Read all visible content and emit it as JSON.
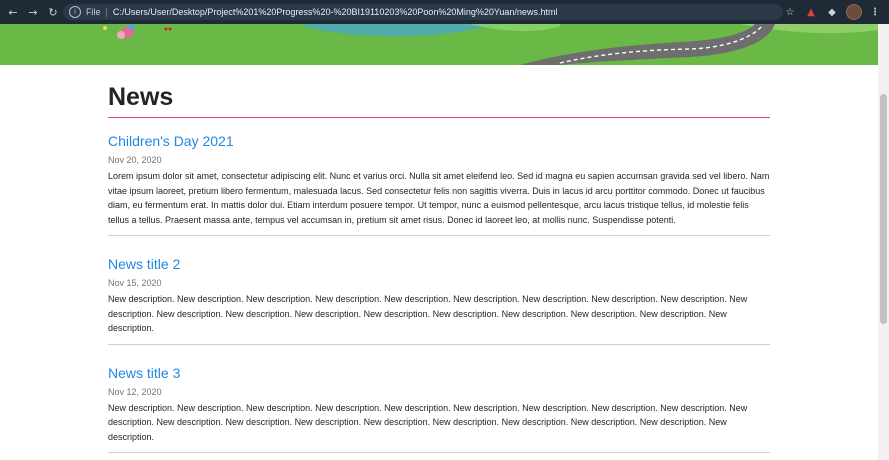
{
  "browser": {
    "scheme_label": "File",
    "url": "C:/Users/User/Desktop/Project%201%20Progress%20-%20BI19110203%20Poon%20Ming%20Yuan/news.html",
    "icons": {
      "back": "arrow-left-icon",
      "forward": "arrow-right-icon",
      "reload": "reload-icon",
      "info": "info-icon",
      "bookmark": "star-icon",
      "extension_a": "extension-icon",
      "extensions": "puzzle-icon",
      "profile": "avatar-icon",
      "menu": "kebab-menu-icon"
    }
  },
  "colors": {
    "banner_grass": "#6ab947",
    "title_rule": "#e83e8c",
    "post_title": "#1e88e5"
  },
  "page": {
    "title": "News"
  },
  "posts": [
    {
      "title": "Children's Day 2021",
      "date": "Nov 20, 2020",
      "description": "Lorem ipsum dolor sit amet, consectetur adipiscing elit. Nunc et varius orci. Nulla sit amet eleifend leo. Sed id magna eu sapien accumsan gravida sed vel libero. Nam vitae ipsum laoreet, pretium libero fermentum, malesuada lacus. Sed consectetur felis non sagittis viverra. Duis in lacus id arcu porttitor commodo. Donec ut faucibus diam, eu fermentum erat. In mattis dolor dui. Etiam interdum posuere tempor. Ut tempor, nunc a euismod pellentesque, arcu lacus tristique tellus, id molestie felis tellus a tellus. Praesent massa ante, tempus vel accumsan in, pretium sit amet risus. Donec id laoreet leo, at mollis nunc. Suspendisse potenti."
    },
    {
      "title": "News title 2",
      "date": "Nov 15, 2020",
      "description": "New description. New description. New description. New description. New description. New description. New description. New description. New description. New description. New description. New description. New description. New description. New description. New description. New description. New description. New description."
    },
    {
      "title": "News title 3",
      "date": "Nov 12, 2020",
      "description": "New description. New description. New description. New description. New description. New description. New description. New description. New description. New description. New description. New description. New description. New description. New description. New description. New description. New description. New description."
    }
  ]
}
